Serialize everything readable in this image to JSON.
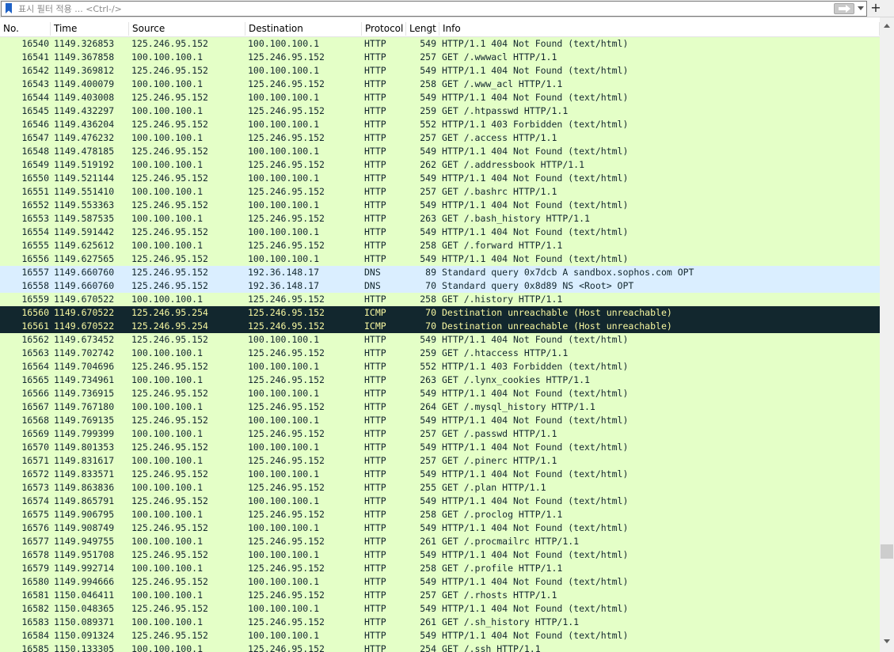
{
  "filter": {
    "placeholder": "표시 필터 적용 ... <Ctrl-/>",
    "value": "",
    "add_label": "+"
  },
  "columns": [
    "No.",
    "Time",
    "Source",
    "Destination",
    "Protocol",
    "Lengt",
    "Info"
  ],
  "scroll": {
    "position": 0.87
  },
  "rows": [
    [
      "16540",
      "1149.326853",
      "125.246.95.152",
      "100.100.100.1",
      "HTTP",
      "549",
      "HTTP/1.1 404 Not Found  (text/html)"
    ],
    [
      "16541",
      "1149.367858",
      "100.100.100.1",
      "125.246.95.152",
      "HTTP",
      "257",
      "GET /.wwwacl HTTP/1.1"
    ],
    [
      "16542",
      "1149.369812",
      "125.246.95.152",
      "100.100.100.1",
      "HTTP",
      "549",
      "HTTP/1.1 404 Not Found  (text/html)"
    ],
    [
      "16543",
      "1149.400079",
      "100.100.100.1",
      "125.246.95.152",
      "HTTP",
      "258",
      "GET /.www_acl HTTP/1.1"
    ],
    [
      "16544",
      "1149.403008",
      "125.246.95.152",
      "100.100.100.1",
      "HTTP",
      "549",
      "HTTP/1.1 404 Not Found  (text/html)"
    ],
    [
      "16545",
      "1149.432297",
      "100.100.100.1",
      "125.246.95.152",
      "HTTP",
      "259",
      "GET /.htpasswd HTTP/1.1"
    ],
    [
      "16546",
      "1149.436204",
      "125.246.95.152",
      "100.100.100.1",
      "HTTP",
      "552",
      "HTTP/1.1 403 Forbidden  (text/html)"
    ],
    [
      "16547",
      "1149.476232",
      "100.100.100.1",
      "125.246.95.152",
      "HTTP",
      "257",
      "GET /.access HTTP/1.1"
    ],
    [
      "16548",
      "1149.478185",
      "125.246.95.152",
      "100.100.100.1",
      "HTTP",
      "549",
      "HTTP/1.1 404 Not Found  (text/html)"
    ],
    [
      "16549",
      "1149.519192",
      "100.100.100.1",
      "125.246.95.152",
      "HTTP",
      "262",
      "GET /.addressbook HTTP/1.1"
    ],
    [
      "16550",
      "1149.521144",
      "125.246.95.152",
      "100.100.100.1",
      "HTTP",
      "549",
      "HTTP/1.1 404 Not Found  (text/html)"
    ],
    [
      "16551",
      "1149.551410",
      "100.100.100.1",
      "125.246.95.152",
      "HTTP",
      "257",
      "GET /.bashrc HTTP/1.1"
    ],
    [
      "16552",
      "1149.553363",
      "125.246.95.152",
      "100.100.100.1",
      "HTTP",
      "549",
      "HTTP/1.1 404 Not Found  (text/html)"
    ],
    [
      "16553",
      "1149.587535",
      "100.100.100.1",
      "125.246.95.152",
      "HTTP",
      "263",
      "GET /.bash_history HTTP/1.1"
    ],
    [
      "16554",
      "1149.591442",
      "125.246.95.152",
      "100.100.100.1",
      "HTTP",
      "549",
      "HTTP/1.1 404 Not Found  (text/html)"
    ],
    [
      "16555",
      "1149.625612",
      "100.100.100.1",
      "125.246.95.152",
      "HTTP",
      "258",
      "GET /.forward HTTP/1.1"
    ],
    [
      "16556",
      "1149.627565",
      "125.246.95.152",
      "100.100.100.1",
      "HTTP",
      "549",
      "HTTP/1.1 404 Not Found  (text/html)"
    ],
    [
      "16557",
      "1149.660760",
      "125.246.95.152",
      "192.36.148.17",
      "DNS",
      "89",
      "Standard query 0x7dcb A sandbox.sophos.com OPT"
    ],
    [
      "16558",
      "1149.660760",
      "125.246.95.152",
      "192.36.148.17",
      "DNS",
      "70",
      "Standard query 0x8d89 NS <Root> OPT"
    ],
    [
      "16559",
      "1149.670522",
      "100.100.100.1",
      "125.246.95.152",
      "HTTP",
      "258",
      "GET /.history HTTP/1.1"
    ],
    [
      "16560",
      "1149.670522",
      "125.246.95.254",
      "125.246.95.152",
      "ICMP",
      "70",
      "Destination unreachable (Host unreachable)"
    ],
    [
      "16561",
      "1149.670522",
      "125.246.95.254",
      "125.246.95.152",
      "ICMP",
      "70",
      "Destination unreachable (Host unreachable)"
    ],
    [
      "16562",
      "1149.673452",
      "125.246.95.152",
      "100.100.100.1",
      "HTTP",
      "549",
      "HTTP/1.1 404 Not Found  (text/html)"
    ],
    [
      "16563",
      "1149.702742",
      "100.100.100.1",
      "125.246.95.152",
      "HTTP",
      "259",
      "GET /.htaccess HTTP/1.1"
    ],
    [
      "16564",
      "1149.704696",
      "125.246.95.152",
      "100.100.100.1",
      "HTTP",
      "552",
      "HTTP/1.1 403 Forbidden  (text/html)"
    ],
    [
      "16565",
      "1149.734961",
      "100.100.100.1",
      "125.246.95.152",
      "HTTP",
      "263",
      "GET /.lynx_cookies HTTP/1.1"
    ],
    [
      "16566",
      "1149.736915",
      "125.246.95.152",
      "100.100.100.1",
      "HTTP",
      "549",
      "HTTP/1.1 404 Not Found  (text/html)"
    ],
    [
      "16567",
      "1149.767180",
      "100.100.100.1",
      "125.246.95.152",
      "HTTP",
      "264",
      "GET /.mysql_history HTTP/1.1"
    ],
    [
      "16568",
      "1149.769135",
      "125.246.95.152",
      "100.100.100.1",
      "HTTP",
      "549",
      "HTTP/1.1 404 Not Found  (text/html)"
    ],
    [
      "16569",
      "1149.799399",
      "100.100.100.1",
      "125.246.95.152",
      "HTTP",
      "257",
      "GET /.passwd HTTP/1.1"
    ],
    [
      "16570",
      "1149.801353",
      "125.246.95.152",
      "100.100.100.1",
      "HTTP",
      "549",
      "HTTP/1.1 404 Not Found  (text/html)"
    ],
    [
      "16571",
      "1149.831617",
      "100.100.100.1",
      "125.246.95.152",
      "HTTP",
      "257",
      "GET /.pinerc HTTP/1.1"
    ],
    [
      "16572",
      "1149.833571",
      "125.246.95.152",
      "100.100.100.1",
      "HTTP",
      "549",
      "HTTP/1.1 404 Not Found  (text/html)"
    ],
    [
      "16573",
      "1149.863836",
      "100.100.100.1",
      "125.246.95.152",
      "HTTP",
      "255",
      "GET /.plan HTTP/1.1"
    ],
    [
      "16574",
      "1149.865791",
      "125.246.95.152",
      "100.100.100.1",
      "HTTP",
      "549",
      "HTTP/1.1 404 Not Found  (text/html)"
    ],
    [
      "16575",
      "1149.906795",
      "100.100.100.1",
      "125.246.95.152",
      "HTTP",
      "258",
      "GET /.proclog HTTP/1.1"
    ],
    [
      "16576",
      "1149.908749",
      "125.246.95.152",
      "100.100.100.1",
      "HTTP",
      "549",
      "HTTP/1.1 404 Not Found  (text/html)"
    ],
    [
      "16577",
      "1149.949755",
      "100.100.100.1",
      "125.246.95.152",
      "HTTP",
      "261",
      "GET /.procmailrc HTTP/1.1"
    ],
    [
      "16578",
      "1149.951708",
      "125.246.95.152",
      "100.100.100.1",
      "HTTP",
      "549",
      "HTTP/1.1 404 Not Found  (text/html)"
    ],
    [
      "16579",
      "1149.992714",
      "100.100.100.1",
      "125.246.95.152",
      "HTTP",
      "258",
      "GET /.profile HTTP/1.1"
    ],
    [
      "16580",
      "1149.994666",
      "125.246.95.152",
      "100.100.100.1",
      "HTTP",
      "549",
      "HTTP/1.1 404 Not Found  (text/html)"
    ],
    [
      "16581",
      "1150.046411",
      "100.100.100.1",
      "125.246.95.152",
      "HTTP",
      "257",
      "GET /.rhosts HTTP/1.1"
    ],
    [
      "16582",
      "1150.048365",
      "125.246.95.152",
      "100.100.100.1",
      "HTTP",
      "549",
      "HTTP/1.1 404 Not Found  (text/html)"
    ],
    [
      "16583",
      "1150.089371",
      "100.100.100.1",
      "125.246.95.152",
      "HTTP",
      "261",
      "GET /.sh_history HTTP/1.1"
    ],
    [
      "16584",
      "1150.091324",
      "125.246.95.152",
      "100.100.100.1",
      "HTTP",
      "549",
      "HTTP/1.1 404 Not Found  (text/html)"
    ],
    [
      "16585",
      "1150.133305",
      "100.100.100.1",
      "125.246.95.152",
      "HTTP",
      "254",
      "GET /.ssh HTTP/1.1"
    ]
  ]
}
